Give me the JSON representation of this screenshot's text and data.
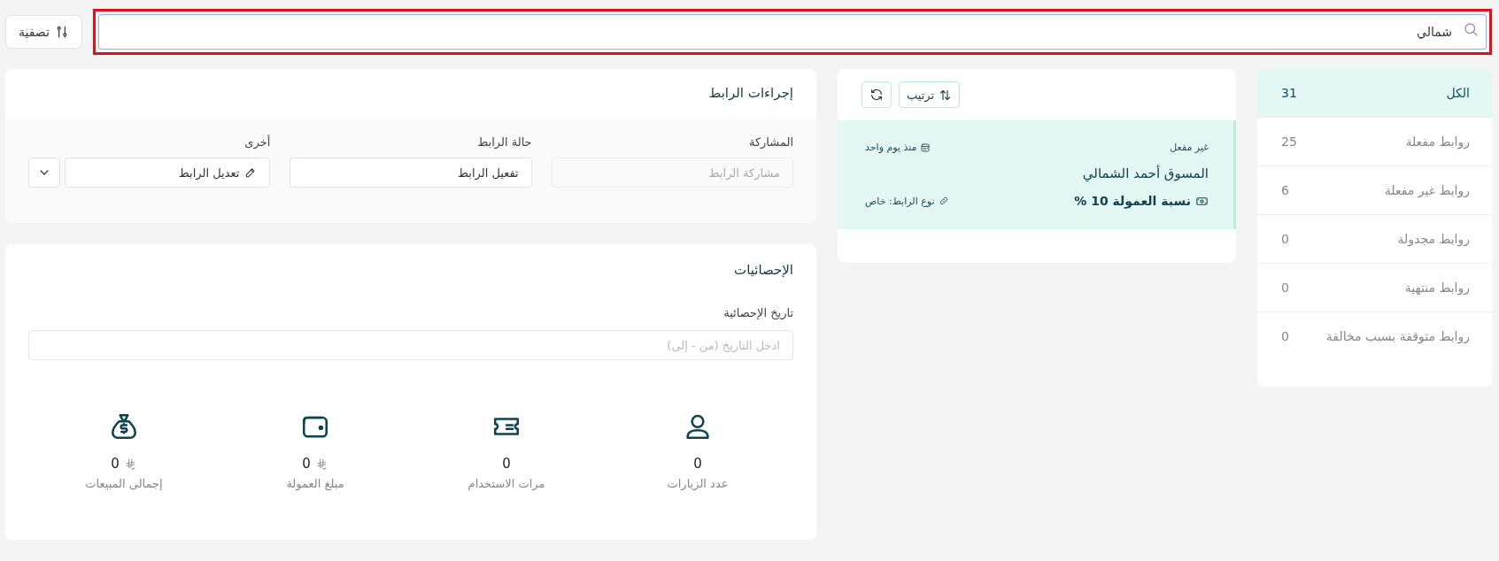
{
  "search": {
    "value": "شمالي",
    "focused": true
  },
  "filter_button": {
    "label": "تصفية"
  },
  "sidebar": {
    "items": [
      {
        "label": "الكل",
        "count": "31",
        "selected": true
      },
      {
        "label": "روابط مفعلة",
        "count": "25",
        "selected": false
      },
      {
        "label": "روابط غير مفعلة",
        "count": "6",
        "selected": false
      },
      {
        "label": "روابط مجدولة",
        "count": "0",
        "selected": false
      },
      {
        "label": "روابط منتهية",
        "count": "0",
        "selected": false
      },
      {
        "label": "روابط متوقفة بسبب مخالفة",
        "count": "0",
        "selected": false
      }
    ]
  },
  "list_toolbar": {
    "sort_label": "ترتيب"
  },
  "link_cards": [
    {
      "status": "غير مفعل",
      "date": "منذ يوم واحد",
      "name": "المسوق أحمد الشمالي",
      "commission": "نسبة العمولة 10 %",
      "link_type": "نوع الرابط: خاص",
      "selected": true
    }
  ],
  "actions": {
    "title": "إجراءات الرابط",
    "fields": [
      {
        "kind": "disabled",
        "label": "المشاركة",
        "text": "مشاركة الرابط"
      },
      {
        "kind": "button",
        "label": "حالة الرابط",
        "text": "تفعيل الرابط"
      },
      {
        "kind": "split",
        "label": "أخرى",
        "text": "تعديل الرابط"
      }
    ]
  },
  "stats": {
    "title": "الإحصائيات",
    "date_label": "تاريخ الإحصائية",
    "date_placeholder": "ادخل التاريخ (من - إلى)",
    "items": [
      {
        "kind": "visits",
        "value": "0",
        "currency": false,
        "label": "عدد الزيارات"
      },
      {
        "kind": "uses",
        "value": "0",
        "currency": false,
        "label": "مرات الاستخدام"
      },
      {
        "kind": "commission",
        "value": "0",
        "currency": true,
        "label": "مبلغ العمولة"
      },
      {
        "kind": "sales",
        "value": "0",
        "currency": true,
        "label": "إجمالى المبيعات"
      }
    ]
  }
}
